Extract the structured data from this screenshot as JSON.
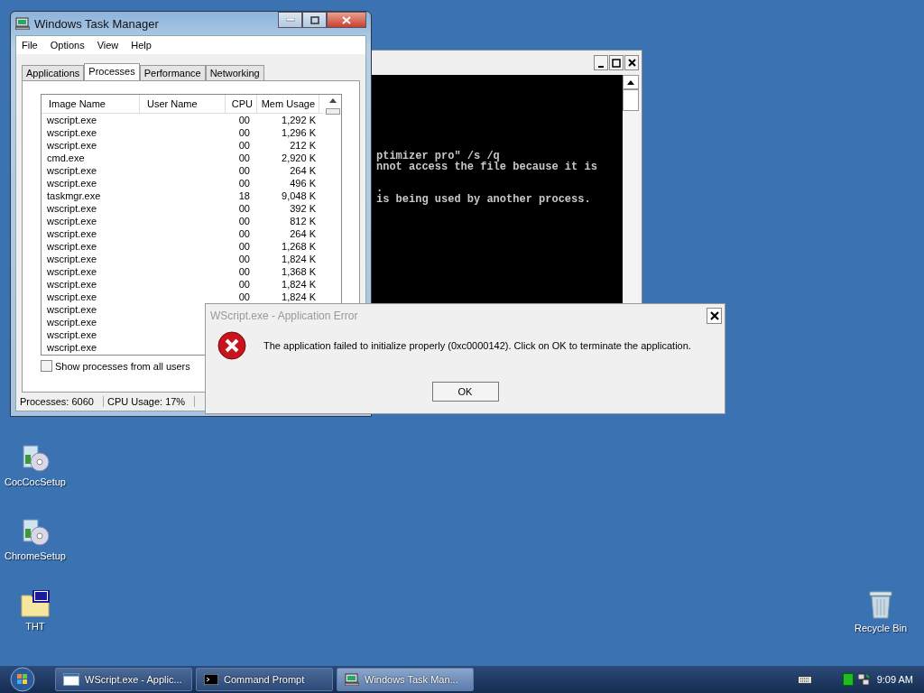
{
  "desktop_icons": [
    {
      "label": "CocCocSetup",
      "kind": "installer"
    },
    {
      "label": "ChromeSetup",
      "kind": "installer"
    },
    {
      "label": "THT",
      "kind": "iso"
    },
    {
      "label": "Recycle Bin",
      "kind": "recycle"
    }
  ],
  "console": {
    "lines": [
      {
        "kind": "text",
        "text": "ptimizer pro\" /s /q"
      },
      {
        "kind": "text",
        "text": "nnot access the file because it is"
      },
      {
        "kind": "blank"
      },
      {
        "kind": "text",
        "text": "."
      },
      {
        "kind": "text",
        "text": "is being used by another process."
      }
    ]
  },
  "task_manager": {
    "title": "Windows Task Manager",
    "menu": [
      "File",
      "Options",
      "View",
      "Help"
    ],
    "tabs": [
      {
        "label": "Applications",
        "selected": false
      },
      {
        "label": "Processes",
        "selected": true
      },
      {
        "label": "Performance",
        "selected": false
      },
      {
        "label": "Networking",
        "selected": false
      }
    ],
    "columns": [
      "Image Name",
      "User Name",
      "CPU",
      "Mem Usage"
    ],
    "rows": [
      {
        "image_name": "wscript.exe",
        "cpu": "00",
        "mem": "1,292 K"
      },
      {
        "image_name": "wscript.exe",
        "cpu": "00",
        "mem": "1,296 K"
      },
      {
        "image_name": "wscript.exe",
        "cpu": "00",
        "mem": "212 K"
      },
      {
        "image_name": "cmd.exe",
        "cpu": "00",
        "mem": "2,920 K"
      },
      {
        "image_name": "wscript.exe",
        "cpu": "00",
        "mem": "264 K"
      },
      {
        "image_name": "wscript.exe",
        "cpu": "00",
        "mem": "496 K"
      },
      {
        "image_name": "taskmgr.exe",
        "cpu": "18",
        "mem": "9,048 K"
      },
      {
        "image_name": "wscript.exe",
        "cpu": "00",
        "mem": "392 K"
      },
      {
        "image_name": "wscript.exe",
        "cpu": "00",
        "mem": "812 K"
      },
      {
        "image_name": "wscript.exe",
        "cpu": "00",
        "mem": "264 K"
      },
      {
        "image_name": "wscript.exe",
        "cpu": "00",
        "mem": "1,268 K"
      },
      {
        "image_name": "wscript.exe",
        "cpu": "00",
        "mem": "1,824 K"
      },
      {
        "image_name": "wscript.exe",
        "cpu": "00",
        "mem": "1,368 K"
      },
      {
        "image_name": "wscript.exe",
        "cpu": "00",
        "mem": "1,824 K"
      },
      {
        "image_name": "wscript.exe",
        "cpu": "00",
        "mem": "1,824 K"
      },
      {
        "image_name": "wscript.exe"
      },
      {
        "image_name": "wscript.exe"
      },
      {
        "image_name": "wscript.exe"
      },
      {
        "image_name": "wscript.exe"
      }
    ],
    "show_all_users": {
      "label": "Show processes from all users",
      "checked": false
    },
    "status": [
      "Processes: 6060",
      "CPU Usage: 17%"
    ]
  },
  "error_dialog": {
    "title": "WScript.exe - Application Error",
    "message": "The application failed to initialize properly (0xc0000142). Click on OK to terminate the application.",
    "button": "OK"
  },
  "taskbar": {
    "buttons": [
      {
        "label": "WScript.exe - Applic...",
        "kind": "window",
        "selected": false
      },
      {
        "label": "Command Prompt",
        "kind": "console",
        "selected": false
      },
      {
        "label": "Windows Task Man...",
        "kind": "taskmgr",
        "selected": true
      }
    ],
    "clock": "9:09 AM"
  }
}
